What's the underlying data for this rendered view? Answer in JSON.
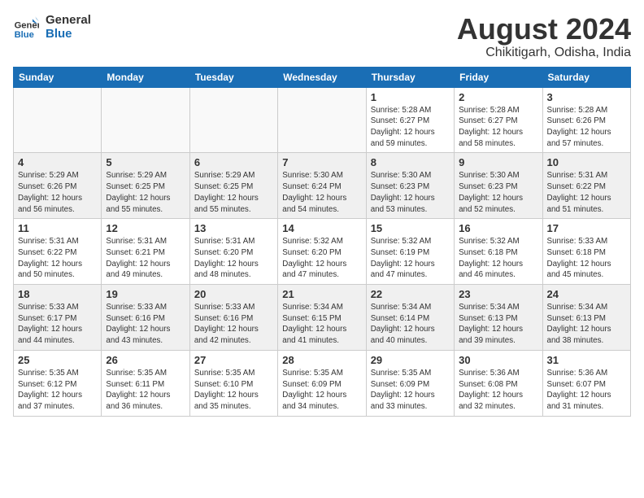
{
  "logo": {
    "line1": "General",
    "line2": "Blue"
  },
  "title": {
    "month_year": "August 2024",
    "location": "Chikitigarh, Odisha, India"
  },
  "days_of_week": [
    "Sunday",
    "Monday",
    "Tuesday",
    "Wednesday",
    "Thursday",
    "Friday",
    "Saturday"
  ],
  "weeks": [
    [
      {
        "day": "",
        "info": ""
      },
      {
        "day": "",
        "info": ""
      },
      {
        "day": "",
        "info": ""
      },
      {
        "day": "",
        "info": ""
      },
      {
        "day": "1",
        "info": "Sunrise: 5:28 AM\nSunset: 6:27 PM\nDaylight: 12 hours\nand 59 minutes."
      },
      {
        "day": "2",
        "info": "Sunrise: 5:28 AM\nSunset: 6:27 PM\nDaylight: 12 hours\nand 58 minutes."
      },
      {
        "day": "3",
        "info": "Sunrise: 5:28 AM\nSunset: 6:26 PM\nDaylight: 12 hours\nand 57 minutes."
      }
    ],
    [
      {
        "day": "4",
        "info": "Sunrise: 5:29 AM\nSunset: 6:26 PM\nDaylight: 12 hours\nand 56 minutes."
      },
      {
        "day": "5",
        "info": "Sunrise: 5:29 AM\nSunset: 6:25 PM\nDaylight: 12 hours\nand 55 minutes."
      },
      {
        "day": "6",
        "info": "Sunrise: 5:29 AM\nSunset: 6:25 PM\nDaylight: 12 hours\nand 55 minutes."
      },
      {
        "day": "7",
        "info": "Sunrise: 5:30 AM\nSunset: 6:24 PM\nDaylight: 12 hours\nand 54 minutes."
      },
      {
        "day": "8",
        "info": "Sunrise: 5:30 AM\nSunset: 6:23 PM\nDaylight: 12 hours\nand 53 minutes."
      },
      {
        "day": "9",
        "info": "Sunrise: 5:30 AM\nSunset: 6:23 PM\nDaylight: 12 hours\nand 52 minutes."
      },
      {
        "day": "10",
        "info": "Sunrise: 5:31 AM\nSunset: 6:22 PM\nDaylight: 12 hours\nand 51 minutes."
      }
    ],
    [
      {
        "day": "11",
        "info": "Sunrise: 5:31 AM\nSunset: 6:22 PM\nDaylight: 12 hours\nand 50 minutes."
      },
      {
        "day": "12",
        "info": "Sunrise: 5:31 AM\nSunset: 6:21 PM\nDaylight: 12 hours\nand 49 minutes."
      },
      {
        "day": "13",
        "info": "Sunrise: 5:31 AM\nSunset: 6:20 PM\nDaylight: 12 hours\nand 48 minutes."
      },
      {
        "day": "14",
        "info": "Sunrise: 5:32 AM\nSunset: 6:20 PM\nDaylight: 12 hours\nand 47 minutes."
      },
      {
        "day": "15",
        "info": "Sunrise: 5:32 AM\nSunset: 6:19 PM\nDaylight: 12 hours\nand 47 minutes."
      },
      {
        "day": "16",
        "info": "Sunrise: 5:32 AM\nSunset: 6:18 PM\nDaylight: 12 hours\nand 46 minutes."
      },
      {
        "day": "17",
        "info": "Sunrise: 5:33 AM\nSunset: 6:18 PM\nDaylight: 12 hours\nand 45 minutes."
      }
    ],
    [
      {
        "day": "18",
        "info": "Sunrise: 5:33 AM\nSunset: 6:17 PM\nDaylight: 12 hours\nand 44 minutes."
      },
      {
        "day": "19",
        "info": "Sunrise: 5:33 AM\nSunset: 6:16 PM\nDaylight: 12 hours\nand 43 minutes."
      },
      {
        "day": "20",
        "info": "Sunrise: 5:33 AM\nSunset: 6:16 PM\nDaylight: 12 hours\nand 42 minutes."
      },
      {
        "day": "21",
        "info": "Sunrise: 5:34 AM\nSunset: 6:15 PM\nDaylight: 12 hours\nand 41 minutes."
      },
      {
        "day": "22",
        "info": "Sunrise: 5:34 AM\nSunset: 6:14 PM\nDaylight: 12 hours\nand 40 minutes."
      },
      {
        "day": "23",
        "info": "Sunrise: 5:34 AM\nSunset: 6:13 PM\nDaylight: 12 hours\nand 39 minutes."
      },
      {
        "day": "24",
        "info": "Sunrise: 5:34 AM\nSunset: 6:13 PM\nDaylight: 12 hours\nand 38 minutes."
      }
    ],
    [
      {
        "day": "25",
        "info": "Sunrise: 5:35 AM\nSunset: 6:12 PM\nDaylight: 12 hours\nand 37 minutes."
      },
      {
        "day": "26",
        "info": "Sunrise: 5:35 AM\nSunset: 6:11 PM\nDaylight: 12 hours\nand 36 minutes."
      },
      {
        "day": "27",
        "info": "Sunrise: 5:35 AM\nSunset: 6:10 PM\nDaylight: 12 hours\nand 35 minutes."
      },
      {
        "day": "28",
        "info": "Sunrise: 5:35 AM\nSunset: 6:09 PM\nDaylight: 12 hours\nand 34 minutes."
      },
      {
        "day": "29",
        "info": "Sunrise: 5:35 AM\nSunset: 6:09 PM\nDaylight: 12 hours\nand 33 minutes."
      },
      {
        "day": "30",
        "info": "Sunrise: 5:36 AM\nSunset: 6:08 PM\nDaylight: 12 hours\nand 32 minutes."
      },
      {
        "day": "31",
        "info": "Sunrise: 5:36 AM\nSunset: 6:07 PM\nDaylight: 12 hours\nand 31 minutes."
      }
    ]
  ]
}
